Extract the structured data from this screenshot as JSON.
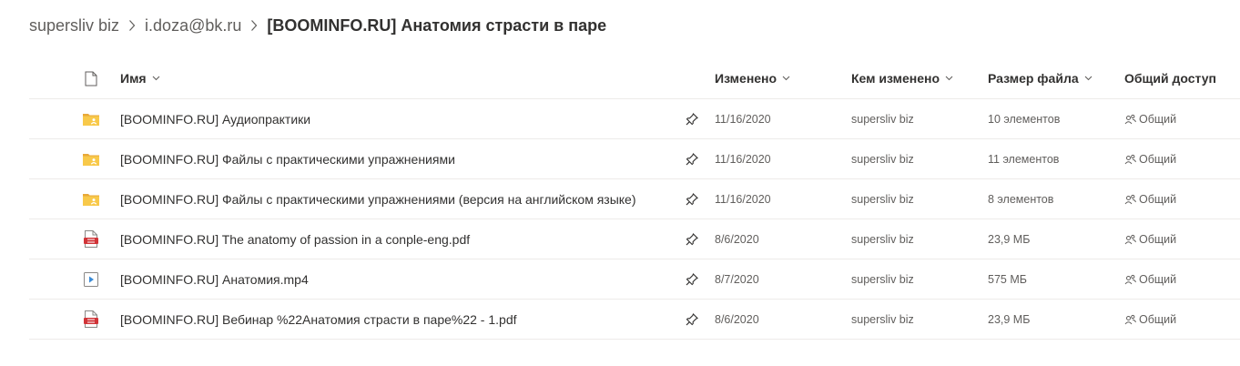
{
  "breadcrumb": {
    "items": [
      "supersliv biz",
      "i.doza@bk.ru",
      "[BOOMINFO.RU] Анатомия страсти в паре"
    ]
  },
  "columns": {
    "file_icon": "file-icon",
    "name": "Имя",
    "modified": "Изменено",
    "modified_by": "Кем изменено",
    "size": "Размер файла",
    "sharing": "Общий доступ"
  },
  "rows": [
    {
      "icon": "shared-folder-icon",
      "name": "[BOOMINFO.RU] Аудиопрактики",
      "modified": "11/16/2020",
      "modified_by": "supersliv biz",
      "size": "10 элементов",
      "sharing": "Общий"
    },
    {
      "icon": "shared-folder-icon",
      "name": "[BOOMINFO.RU] Файлы с практическими упражнениями",
      "modified": "11/16/2020",
      "modified_by": "supersliv biz",
      "size": "11 элементов",
      "sharing": "Общий"
    },
    {
      "icon": "shared-folder-icon",
      "name": "[BOOMINFO.RU] Файлы с практическими упражнениями (версия на английском языке)",
      "modified": "11/16/2020",
      "modified_by": "supersliv biz",
      "size": "8 элементов",
      "sharing": "Общий"
    },
    {
      "icon": "pdf-file-icon",
      "name": "[BOOMINFO.RU] The anatomy of passion in a conple-eng.pdf",
      "modified": "8/6/2020",
      "modified_by": "supersliv biz",
      "size": "23,9 МБ",
      "sharing": "Общий"
    },
    {
      "icon": "video-file-icon",
      "name": "[BOOMINFO.RU] Анатомия.mp4",
      "modified": "8/7/2020",
      "modified_by": "supersliv biz",
      "size": "575 МБ",
      "sharing": "Общий"
    },
    {
      "icon": "pdf-file-icon",
      "name": "[BOOMINFO.RU] Вебинар %22Анатомия страсти в паре%22 - 1.pdf",
      "modified": "8/6/2020",
      "modified_by": "supersliv biz",
      "size": "23,9 МБ",
      "sharing": "Общий"
    }
  ],
  "colors": {
    "folder": "#f8c94a",
    "folder_back": "#e8a93a",
    "pdf": "#d13438",
    "video": "#3b8bd6",
    "text": "#323130",
    "secondary_text": "#605e5c",
    "divider": "#edebe9"
  }
}
